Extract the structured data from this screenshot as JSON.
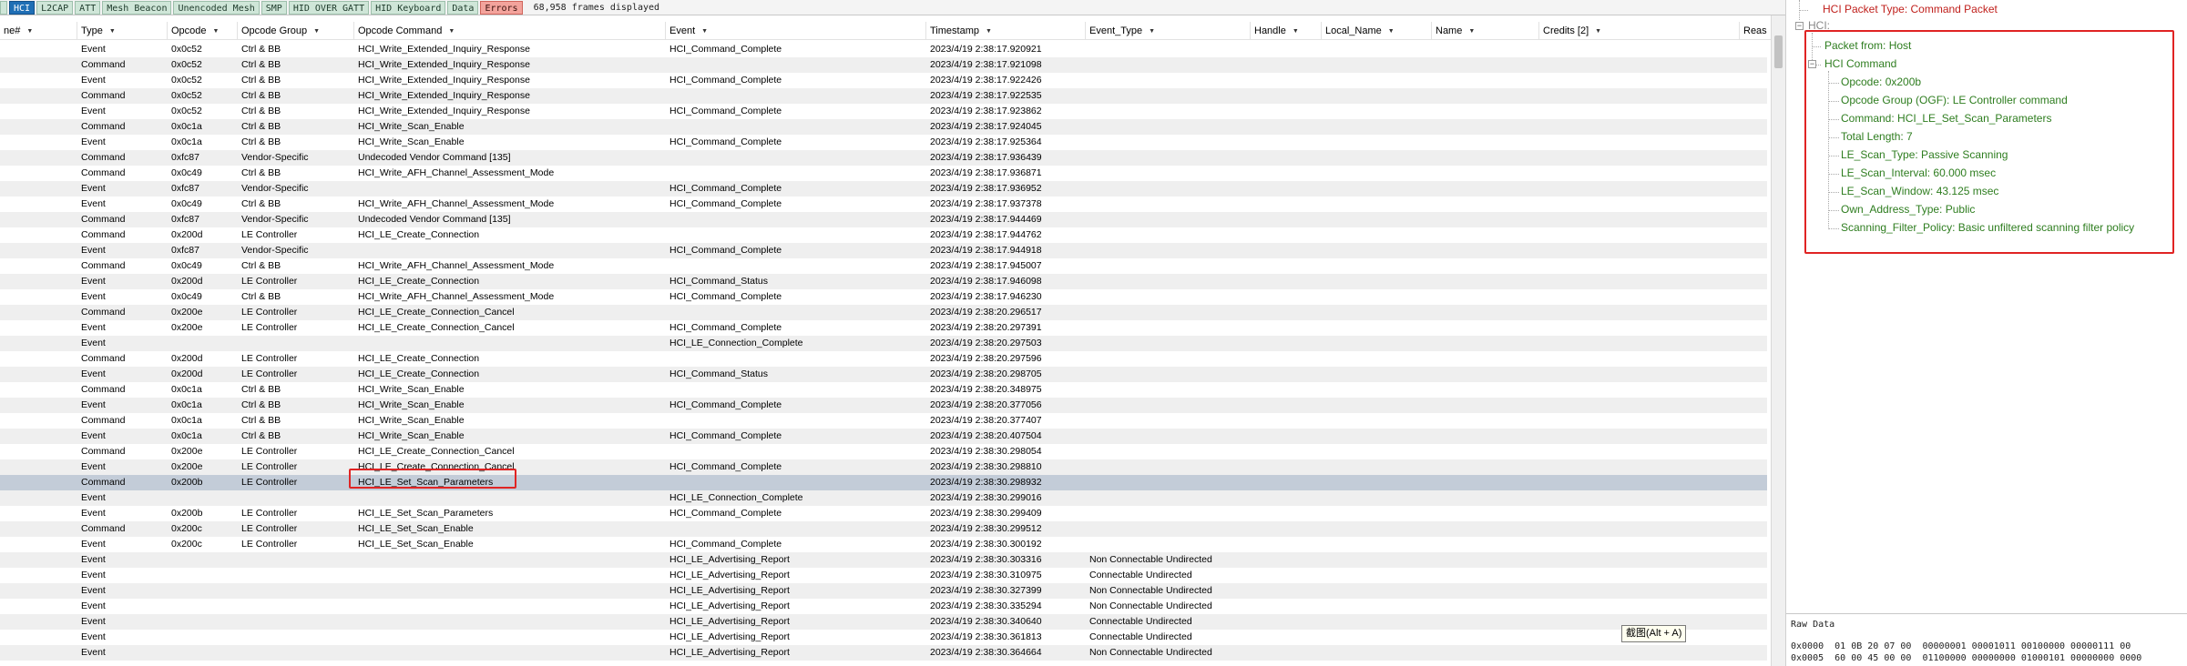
{
  "tabs": [
    {
      "label": "",
      "selected": false
    },
    {
      "label": "HCI",
      "selected": true
    },
    {
      "label": "L2CAP",
      "selected": false
    },
    {
      "label": "ATT",
      "selected": false
    },
    {
      "label": "Mesh Beacon",
      "selected": false
    },
    {
      "label": "Unencoded Mesh",
      "selected": false
    },
    {
      "label": "SMP",
      "selected": false
    },
    {
      "label": "HID OVER GATT",
      "selected": false
    },
    {
      "label": "HID Keyboard",
      "selected": false
    },
    {
      "label": "Data",
      "selected": false
    },
    {
      "label": "Errors",
      "selected": false
    }
  ],
  "frame_count": "68,958 frames displayed",
  "columns": {
    "name": "ne#",
    "type": "Type",
    "opcode": "Opcode",
    "opcode_group": "Opcode Group",
    "opcode_command": "Opcode Command",
    "event": "Event",
    "timestamp": "Timestamp",
    "event_type": "Event_Type",
    "handle": "Handle",
    "local_name": "Local_Name",
    "name_col": "Name",
    "credits": "Credits [2]",
    "reason": "Reas"
  },
  "rows": [
    {
      "type": "Event",
      "opcode": "0x0c52",
      "group": "Ctrl & BB",
      "command": "HCI_Write_Extended_Inquiry_Response",
      "event": "HCI_Command_Complete",
      "timestamp": "2023/4/19 2:38:17.920921",
      "event_type": ""
    },
    {
      "type": "Command",
      "opcode": "0x0c52",
      "group": "Ctrl & BB",
      "command": "HCI_Write_Extended_Inquiry_Response",
      "event": "",
      "timestamp": "2023/4/19 2:38:17.921098",
      "event_type": ""
    },
    {
      "type": "Event",
      "opcode": "0x0c52",
      "group": "Ctrl & BB",
      "command": "HCI_Write_Extended_Inquiry_Response",
      "event": "HCI_Command_Complete",
      "timestamp": "2023/4/19 2:38:17.922426",
      "event_type": ""
    },
    {
      "type": "Command",
      "opcode": "0x0c52",
      "group": "Ctrl & BB",
      "command": "HCI_Write_Extended_Inquiry_Response",
      "event": "",
      "timestamp": "2023/4/19 2:38:17.922535",
      "event_type": ""
    },
    {
      "type": "Event",
      "opcode": "0x0c52",
      "group": "Ctrl & BB",
      "command": "HCI_Write_Extended_Inquiry_Response",
      "event": "HCI_Command_Complete",
      "timestamp": "2023/4/19 2:38:17.923862",
      "event_type": ""
    },
    {
      "type": "Command",
      "opcode": "0x0c1a",
      "group": "Ctrl & BB",
      "command": "HCI_Write_Scan_Enable",
      "event": "",
      "timestamp": "2023/4/19 2:38:17.924045",
      "event_type": ""
    },
    {
      "type": "Event",
      "opcode": "0x0c1a",
      "group": "Ctrl & BB",
      "command": "HCI_Write_Scan_Enable",
      "event": "HCI_Command_Complete",
      "timestamp": "2023/4/19 2:38:17.925364",
      "event_type": ""
    },
    {
      "type": "Command",
      "opcode": "0xfc87",
      "group": "Vendor-Specific",
      "command": "Undecoded Vendor Command [135]",
      "event": "",
      "timestamp": "2023/4/19 2:38:17.936439",
      "event_type": ""
    },
    {
      "type": "Command",
      "opcode": "0x0c49",
      "group": "Ctrl & BB",
      "command": "HCI_Write_AFH_Channel_Assessment_Mode",
      "event": "",
      "timestamp": "2023/4/19 2:38:17.936871",
      "event_type": ""
    },
    {
      "type": "Event",
      "opcode": "0xfc87",
      "group": "Vendor-Specific",
      "command": "",
      "event": "HCI_Command_Complete",
      "timestamp": "2023/4/19 2:38:17.936952",
      "event_type": ""
    },
    {
      "type": "Event",
      "opcode": "0x0c49",
      "group": "Ctrl & BB",
      "command": "HCI_Write_AFH_Channel_Assessment_Mode",
      "event": "HCI_Command_Complete",
      "timestamp": "2023/4/19 2:38:17.937378",
      "event_type": ""
    },
    {
      "type": "Command",
      "opcode": "0xfc87",
      "group": "Vendor-Specific",
      "command": "Undecoded Vendor Command [135]",
      "event": "",
      "timestamp": "2023/4/19 2:38:17.944469",
      "event_type": ""
    },
    {
      "type": "Command",
      "opcode": "0x200d",
      "group": "LE Controller",
      "command": "HCI_LE_Create_Connection",
      "event": "",
      "timestamp": "2023/4/19 2:38:17.944762",
      "event_type": ""
    },
    {
      "type": "Event",
      "opcode": "0xfc87",
      "group": "Vendor-Specific",
      "command": "",
      "event": "HCI_Command_Complete",
      "timestamp": "2023/4/19 2:38:17.944918",
      "event_type": ""
    },
    {
      "type": "Command",
      "opcode": "0x0c49",
      "group": "Ctrl & BB",
      "command": "HCI_Write_AFH_Channel_Assessment_Mode",
      "event": "",
      "timestamp": "2023/4/19 2:38:17.945007",
      "event_type": ""
    },
    {
      "type": "Event",
      "opcode": "0x200d",
      "group": "LE Controller",
      "command": "HCI_LE_Create_Connection",
      "event": "HCI_Command_Status",
      "timestamp": "2023/4/19 2:38:17.946098",
      "event_type": ""
    },
    {
      "type": "Event",
      "opcode": "0x0c49",
      "group": "Ctrl & BB",
      "command": "HCI_Write_AFH_Channel_Assessment_Mode",
      "event": "HCI_Command_Complete",
      "timestamp": "2023/4/19 2:38:17.946230",
      "event_type": ""
    },
    {
      "type": "Command",
      "opcode": "0x200e",
      "group": "LE Controller",
      "command": "HCI_LE_Create_Connection_Cancel",
      "event": "",
      "timestamp": "2023/4/19 2:38:20.296517",
      "event_type": ""
    },
    {
      "type": "Event",
      "opcode": "0x200e",
      "group": "LE Controller",
      "command": "HCI_LE_Create_Connection_Cancel",
      "event": "HCI_Command_Complete",
      "timestamp": "2023/4/19 2:38:20.297391",
      "event_type": ""
    },
    {
      "type": "Event",
      "opcode": "",
      "group": "",
      "command": "",
      "event": "HCI_LE_Connection_Complete",
      "timestamp": "2023/4/19 2:38:20.297503",
      "event_type": ""
    },
    {
      "type": "Command",
      "opcode": "0x200d",
      "group": "LE Controller",
      "command": "HCI_LE_Create_Connection",
      "event": "",
      "timestamp": "2023/4/19 2:38:20.297596",
      "event_type": ""
    },
    {
      "type": "Event",
      "opcode": "0x200d",
      "group": "LE Controller",
      "command": "HCI_LE_Create_Connection",
      "event": "HCI_Command_Status",
      "timestamp": "2023/4/19 2:38:20.298705",
      "event_type": ""
    },
    {
      "type": "Command",
      "opcode": "0x0c1a",
      "group": "Ctrl & BB",
      "command": "HCI_Write_Scan_Enable",
      "event": "",
      "timestamp": "2023/4/19 2:38:20.348975",
      "event_type": ""
    },
    {
      "type": "Event",
      "opcode": "0x0c1a",
      "group": "Ctrl & BB",
      "command": "HCI_Write_Scan_Enable",
      "event": "HCI_Command_Complete",
      "timestamp": "2023/4/19 2:38:20.377056",
      "event_type": ""
    },
    {
      "type": "Command",
      "opcode": "0x0c1a",
      "group": "Ctrl & BB",
      "command": "HCI_Write_Scan_Enable",
      "event": "",
      "timestamp": "2023/4/19 2:38:20.377407",
      "event_type": ""
    },
    {
      "type": "Event",
      "opcode": "0x0c1a",
      "group": "Ctrl & BB",
      "command": "HCI_Write_Scan_Enable",
      "event": "HCI_Command_Complete",
      "timestamp": "2023/4/19 2:38:20.407504",
      "event_type": ""
    },
    {
      "type": "Command",
      "opcode": "0x200e",
      "group": "LE Controller",
      "command": "HCI_LE_Create_Connection_Cancel",
      "event": "",
      "timestamp": "2023/4/19 2:38:30.298054",
      "event_type": ""
    },
    {
      "type": "Event",
      "opcode": "0x200e",
      "group": "LE Controller",
      "command": "HCI_LE_Create_Connection_Cancel",
      "event": "HCI_Command_Complete",
      "timestamp": "2023/4/19 2:38:30.298810",
      "event_type": ""
    },
    {
      "type": "Command",
      "opcode": "0x200b",
      "group": "LE Controller",
      "command": "HCI_LE_Set_Scan_Parameters",
      "event": "",
      "timestamp": "2023/4/19 2:38:30.298932",
      "event_type": "",
      "selected": true
    },
    {
      "type": "Event",
      "opcode": "",
      "group": "",
      "command": "",
      "event": "HCI_LE_Connection_Complete",
      "timestamp": "2023/4/19 2:38:30.299016",
      "event_type": ""
    },
    {
      "type": "Event",
      "opcode": "0x200b",
      "group": "LE Controller",
      "command": "HCI_LE_Set_Scan_Parameters",
      "event": "HCI_Command_Complete",
      "timestamp": "2023/4/19 2:38:30.299409",
      "event_type": ""
    },
    {
      "type": "Command",
      "opcode": "0x200c",
      "group": "LE Controller",
      "command": "HCI_LE_Set_Scan_Enable",
      "event": "",
      "timestamp": "2023/4/19 2:38:30.299512",
      "event_type": ""
    },
    {
      "type": "Event",
      "opcode": "0x200c",
      "group": "LE Controller",
      "command": "HCI_LE_Set_Scan_Enable",
      "event": "HCI_Command_Complete",
      "timestamp": "2023/4/19 2:38:30.300192",
      "event_type": ""
    },
    {
      "type": "Event",
      "opcode": "",
      "group": "",
      "command": "",
      "event": "HCI_LE_Advertising_Report",
      "timestamp": "2023/4/19 2:38:30.303316",
      "event_type": "Non Connectable Undirected"
    },
    {
      "type": "Event",
      "opcode": "",
      "group": "",
      "command": "",
      "event": "HCI_LE_Advertising_Report",
      "timestamp": "2023/4/19 2:38:30.310975",
      "event_type": "Connectable Undirected"
    },
    {
      "type": "Event",
      "opcode": "",
      "group": "",
      "command": "",
      "event": "HCI_LE_Advertising_Report",
      "timestamp": "2023/4/19 2:38:30.327399",
      "event_type": "Non Connectable Undirected"
    },
    {
      "type": "Event",
      "opcode": "",
      "group": "",
      "command": "",
      "event": "HCI_LE_Advertising_Report",
      "timestamp": "2023/4/19 2:38:30.335294",
      "event_type": "Non Connectable Undirected"
    },
    {
      "type": "Event",
      "opcode": "",
      "group": "",
      "command": "",
      "event": "HCI_LE_Advertising_Report",
      "timestamp": "2023/4/19 2:38:30.340640",
      "event_type": "Connectable Undirected"
    },
    {
      "type": "Event",
      "opcode": "",
      "group": "",
      "command": "",
      "event": "HCI_LE_Advertising_Report",
      "timestamp": "2023/4/19 2:38:30.361813",
      "event_type": "Connectable Undirected"
    },
    {
      "type": "Event",
      "opcode": "",
      "group": "",
      "command": "",
      "event": "HCI_LE_Advertising_Report",
      "timestamp": "2023/4/19 2:38:30.364664",
      "event_type": "Non Connectable Undirected"
    }
  ],
  "tree": {
    "packet_type": "HCI Packet Type: Command Packet",
    "hci_label": "HCI:",
    "packet_from": "Packet from: Host",
    "hci_command": "HCI Command",
    "fields": [
      "Opcode: 0x200b",
      "Opcode Group (OGF): LE Controller command",
      "Command: HCI_LE_Set_Scan_Parameters",
      "Total Length: 7",
      "LE_Scan_Type: Passive Scanning",
      "LE_Scan_Interval: 60.000 msec",
      "LE_Scan_Window: 43.125 msec",
      "Own_Address_Type: Public",
      "Scanning_Filter_Policy: Basic unfiltered scanning filter policy"
    ]
  },
  "raw_data": {
    "title": "Raw Data",
    "lines": [
      "0x0000  01 0B 20 07 00  00000001 00001011 00100000 00000111 00",
      "0x0005  60 00 45 00 00  01100000 00000000 01000101 00000000 0000"
    ]
  },
  "tooltip": "截图(Alt + A)",
  "colors": {
    "tree_green": "#2e7d1f",
    "tree_red": "#c0201c",
    "highlight_red": "#e02424",
    "selected_row": "#c3ccd8",
    "selected_tab": "#1f6fb5",
    "errors_tab": "#f3a39c"
  }
}
